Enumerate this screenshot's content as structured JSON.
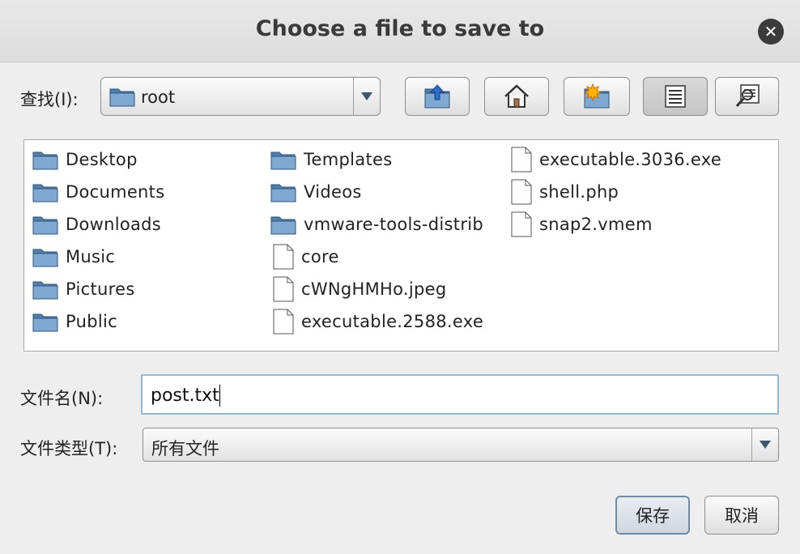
{
  "dialog": {
    "title": "Choose a file to save to",
    "close_icon": "close-icon"
  },
  "look_in": {
    "label": "查找(I):",
    "value": "root"
  },
  "toolbar": {
    "buttons": [
      {
        "name": "up-one-level-button",
        "icon": "folder-up-icon"
      },
      {
        "name": "home-button",
        "icon": "home-icon"
      },
      {
        "name": "new-folder-button",
        "icon": "new-folder-icon"
      },
      {
        "name": "list-view-button",
        "icon": "list-icon",
        "active": true
      },
      {
        "name": "details-view-button",
        "icon": "details-icon"
      }
    ]
  },
  "files": {
    "columns": [
      [
        {
          "name": "Desktop",
          "type": "folder"
        },
        {
          "name": "Documents",
          "type": "folder"
        },
        {
          "name": "Downloads",
          "type": "folder"
        },
        {
          "name": "Music",
          "type": "folder"
        },
        {
          "name": "Pictures",
          "type": "folder"
        },
        {
          "name": "Public",
          "type": "folder"
        }
      ],
      [
        {
          "name": "Templates",
          "type": "folder"
        },
        {
          "name": "Videos",
          "type": "folder"
        },
        {
          "name": "vmware-tools-distrib",
          "type": "folder"
        },
        {
          "name": "core",
          "type": "file"
        },
        {
          "name": "cWNgHMHo.jpeg",
          "type": "file"
        },
        {
          "name": "executable.2588.exe",
          "type": "file"
        }
      ],
      [
        {
          "name": "executable.3036.exe",
          "type": "file"
        },
        {
          "name": "shell.php",
          "type": "file"
        },
        {
          "name": "snap2.vmem",
          "type": "file"
        }
      ]
    ]
  },
  "filename": {
    "label": "文件名(N):",
    "value": "post.txt"
  },
  "filetype": {
    "label": "文件类型(T):",
    "value": "所有文件"
  },
  "actions": {
    "save_label": "保存",
    "cancel_label": "取消"
  },
  "colors": {
    "folder": "#5f8fbd",
    "accent": "#93b7d6"
  }
}
